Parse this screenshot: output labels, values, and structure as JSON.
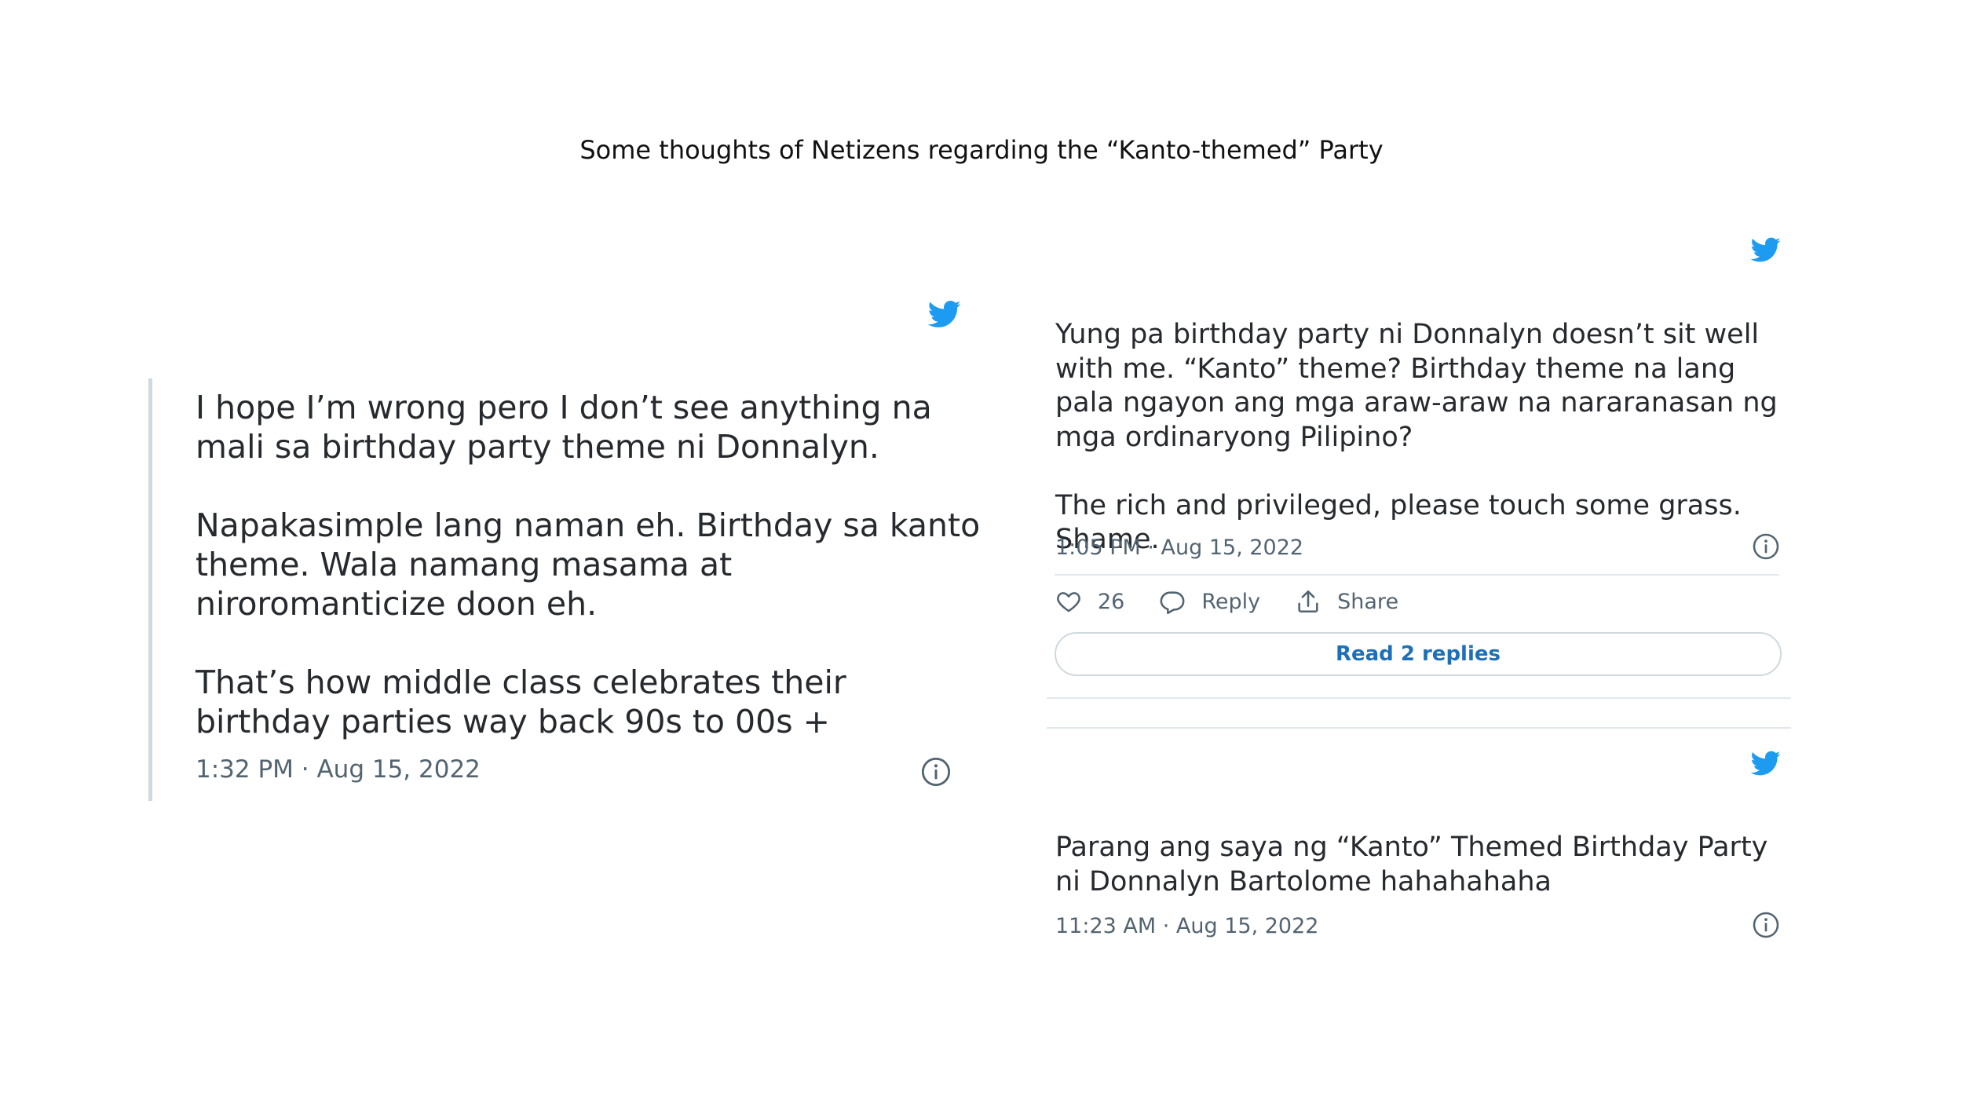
{
  "page": {
    "title": "Some thoughts of Netizens regarding the “Kanto-themed” Party"
  },
  "colors": {
    "twitter_blue": "#1d9bf0",
    "link_blue": "#1d6fb8",
    "meta_gray": "#536471",
    "divider": "#e1e8ed"
  },
  "tweets": [
    {
      "icon": "twitter-bird-icon",
      "paragraphs": [
        "I hope I’m wrong pero I don’t see anything na mali sa birthday party theme ni Donnalyn.",
        "Napakasimple lang naman eh. Birthday sa kanto theme. Wala namang masama at niroromanticize doon eh.",
        "That’s how middle class celebrates their birthday parties way back 90s to 00s +"
      ],
      "timestamp": "1:32 PM · Aug 15, 2022",
      "info_icon": "info-icon"
    },
    {
      "icon": "twitter-bird-icon",
      "paragraphs": [
        "Yung pa birthday party ni Donnalyn doesn’t sit well with me. “Kanto” theme? Birthday theme na lang pala ngayon ang mga araw-araw na nararanasan ng mga ordinaryong Pilipino?",
        "The rich and privileged, please touch some grass. Shame."
      ],
      "timestamp": "1:05 PM · Aug 15, 2022",
      "info_icon": "info-icon",
      "actions": {
        "like_count": "26",
        "reply_label": "Reply",
        "share_label": "Share"
      },
      "read_replies_label": "Read 2 replies"
    },
    {
      "icon": "twitter-bird-icon",
      "paragraphs": [
        "Parang ang saya ng “Kanto” Themed Birthday Party ni Donnalyn Bartolome hahahahaha"
      ],
      "timestamp": "11:23 AM · Aug 15, 2022",
      "info_icon": "info-icon"
    }
  ]
}
